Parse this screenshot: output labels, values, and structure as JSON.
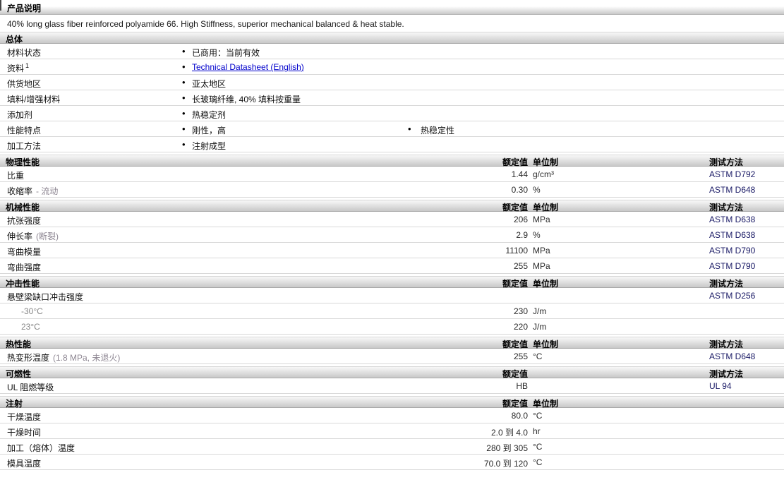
{
  "page": {
    "title": "产品说明"
  },
  "description": "40% long glass fiber reinforced polyamide 66. High Stiffness, superior mechanical balanced & heat stable.",
  "columns": {
    "value": "额定值",
    "unit": "单位制",
    "method": "测试方法"
  },
  "overview": {
    "title": "总体",
    "rows": [
      {
        "label": "材料状态",
        "b1": "已商用：当前有效"
      },
      {
        "label": "资料",
        "sup": "1",
        "b1": "Technical Datasheet (English)"
      },
      {
        "label": "供货地区",
        "b1": "亚太地区"
      },
      {
        "label": "填料/增强材料",
        "b1": "长玻璃纤维, 40% 填料按重量"
      },
      {
        "label": "添加剂",
        "b1": "热稳定剂"
      },
      {
        "label": "性能特点",
        "b1": "刚性，高",
        "b2": "热稳定性"
      },
      {
        "label": "加工方法",
        "b1": "注射成型"
      }
    ]
  },
  "sections": [
    {
      "title": "物理性能",
      "rows": [
        {
          "name": "比重",
          "value": "1.44",
          "unit": "g/cm³",
          "method": "ASTM D792"
        },
        {
          "name": "收缩率",
          "qualifier": "- 流动",
          "value": "0.30",
          "unit": "%",
          "method": "ASTM D648"
        }
      ]
    },
    {
      "title": "机械性能",
      "rows": [
        {
          "name": "抗张强度",
          "value": "206",
          "unit": "MPa",
          "method": "ASTM D638"
        },
        {
          "name": "伸长率",
          "qualifier": "(断裂)",
          "value": "2.9",
          "unit": "%",
          "method": "ASTM D638"
        },
        {
          "name": "弯曲模量",
          "value": "11100",
          "unit": "MPa",
          "method": "ASTM D790"
        },
        {
          "name": "弯曲强度",
          "value": "255",
          "unit": "MPa",
          "method": "ASTM D790"
        }
      ]
    },
    {
      "title": "冲击性能",
      "rows": [
        {
          "name": "悬壁梁缺口冲击强度",
          "method": "ASTM D256"
        },
        {
          "name": "-30°C",
          "value": "230",
          "unit": "J/m"
        },
        {
          "name": "23°C",
          "value": "220",
          "unit": "J/m"
        }
      ]
    },
    {
      "title": "热性能",
      "rows": [
        {
          "name": "热变形温度",
          "qualifier": "(1.8 MPa, 未退火)",
          "value": "255",
          "unit": "°C",
          "method": "ASTM D648"
        }
      ]
    },
    {
      "title": "可燃性",
      "rows": [
        {
          "name": "UL 阻燃等级",
          "value": "HB",
          "method": "UL 94"
        }
      ]
    },
    {
      "title": "注射",
      "rows": [
        {
          "name": "干燥温度",
          "value": "80.0",
          "unit": "°C"
        },
        {
          "name": "干燥时间",
          "value": "2.0 到 4.0",
          "unit": "hr"
        },
        {
          "name": "加工（熔体）温度",
          "value": "280 到 305",
          "unit": "°C"
        },
        {
          "name": "模具温度",
          "value": "70.0 到 120",
          "unit": "°C"
        }
      ]
    }
  ]
}
